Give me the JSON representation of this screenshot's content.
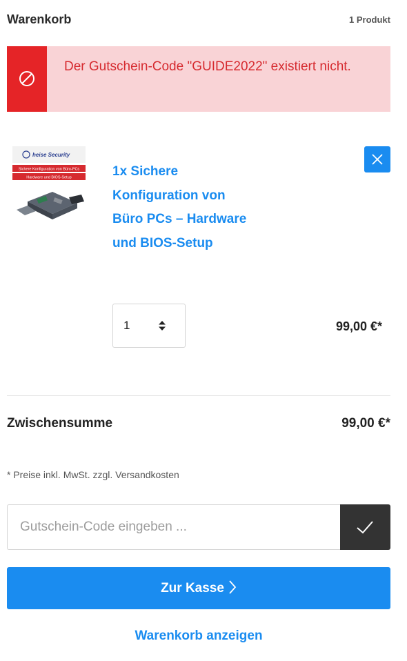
{
  "header": {
    "title": "Warenkorb",
    "count": "1 Produkt"
  },
  "alert": {
    "message": "Der Gutschein-Code \"GUIDE2022\" existiert nicht.",
    "icon": "blocked-icon",
    "color": "#e52427"
  },
  "item": {
    "thumbnail": {
      "brand": "heise Security",
      "line1": "Sichere Konfiguration von Büro-PCs",
      "line2": "Hardware und BIOS-Setup"
    },
    "name": "1x Sichere Konfiguration von Büro PCs – Hardware und BIOS-Setup",
    "quantity": "1",
    "price": "99,00 €*",
    "remove_icon": "close-icon"
  },
  "summary": {
    "subtotal_label": "Zwischensumme",
    "subtotal_value": "99,00 €*",
    "tax_note": "* Preise inkl. MwSt. zzgl. Versandkosten"
  },
  "coupon": {
    "placeholder": "Gutschein-Code eingeben ...",
    "value": "",
    "submit_icon": "checkmark-icon"
  },
  "actions": {
    "checkout_label": "Zur Kasse",
    "checkout_icon": "chevron-right-icon",
    "view_cart_label": "Warenkorb anzeigen"
  },
  "colors": {
    "accent": "#1a8cf0",
    "error": "#e52427",
    "error_bg": "#f9d3d6",
    "dark": "#333333"
  }
}
